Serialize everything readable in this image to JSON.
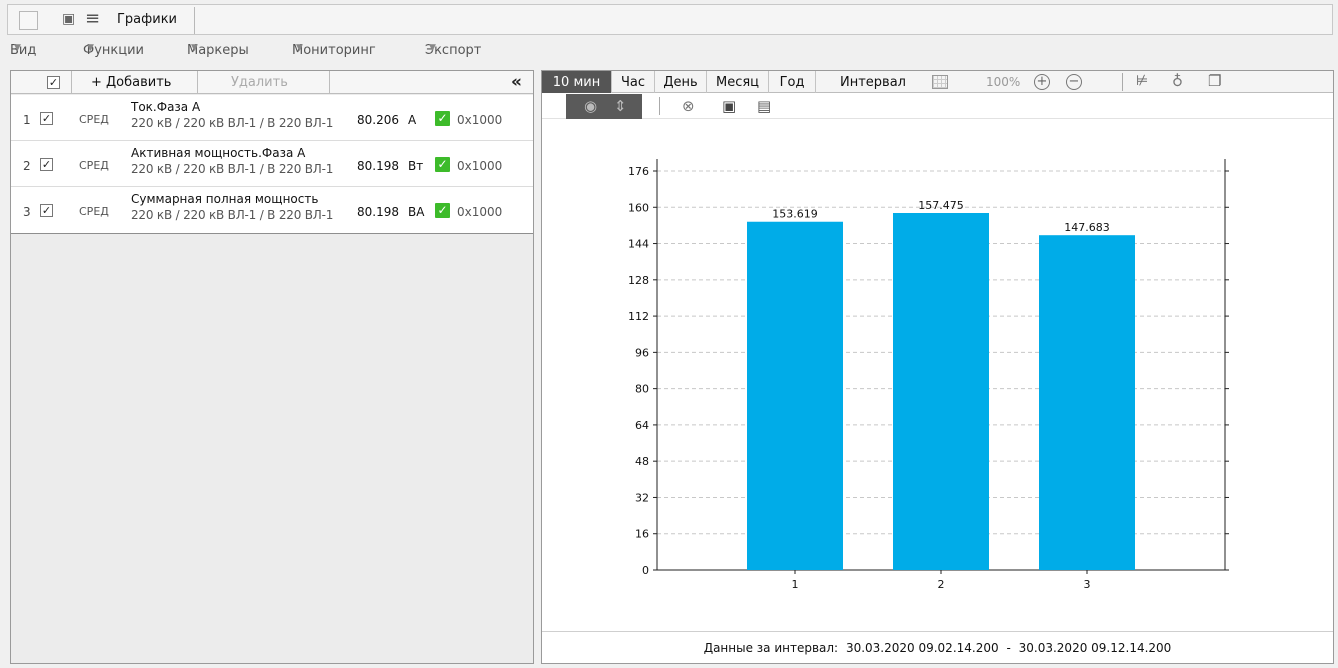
{
  "window": {
    "tab_title": "Графики"
  },
  "menu": [
    {
      "label": "Вид"
    },
    {
      "label": "Функции"
    },
    {
      "label": "Маркеры"
    },
    {
      "label": "Мониторинг"
    },
    {
      "label": "Экспорт"
    }
  ],
  "left": {
    "add_label": "+ Добавить",
    "delete_label": "Удалить",
    "collapse_label": "«",
    "rows": [
      {
        "num": "1",
        "agg": "СРЕД",
        "name": "Ток.Фаза А",
        "source": "220 кВ / 220 кВ ВЛ-1 / В 220 ВЛ-1",
        "value": "80.206",
        "unit": "А",
        "flag": "0x1000"
      },
      {
        "num": "2",
        "agg": "СРЕД",
        "name": "Активная мощность.Фаза А",
        "source": "220 кВ / 220 кВ ВЛ-1 / В 220 ВЛ-1",
        "value": "80.198",
        "unit": "Вт",
        "flag": "0x1000"
      },
      {
        "num": "3",
        "agg": "СРЕД",
        "name": "Суммарная полная мощность",
        "source": "220 кВ / 220 кВ ВЛ-1 / В 220 ВЛ-1",
        "value": "80.198",
        "unit": "ВА",
        "flag": "0x1000"
      }
    ]
  },
  "periods": [
    {
      "label": "10 мин",
      "active": true
    },
    {
      "label": "Час"
    },
    {
      "label": "День"
    },
    {
      "label": "Месяц"
    },
    {
      "label": "Год"
    },
    {
      "label": "Интервал"
    }
  ],
  "zoom": "100%",
  "footer": {
    "label": "Данные за интервал:",
    "from": "30.03.2020 09.02.14.200",
    "sep": "-",
    "to": "30.03.2020 09.12.14.200"
  },
  "colors": {
    "bar": "#00ace8",
    "active_tab": "#555555",
    "ok": "#3dbb2a"
  },
  "chart_data": {
    "type": "bar",
    "categories": [
      "1",
      "2",
      "3"
    ],
    "values": [
      153.619,
      157.475,
      147.683
    ],
    "value_labels": [
      "153.619",
      "157.475",
      "147.683"
    ],
    "ylim": [
      0,
      176
    ],
    "yticks": [
      0,
      16,
      32,
      48,
      64,
      80,
      96,
      112,
      128,
      144,
      160,
      176
    ],
    "grid": true
  }
}
